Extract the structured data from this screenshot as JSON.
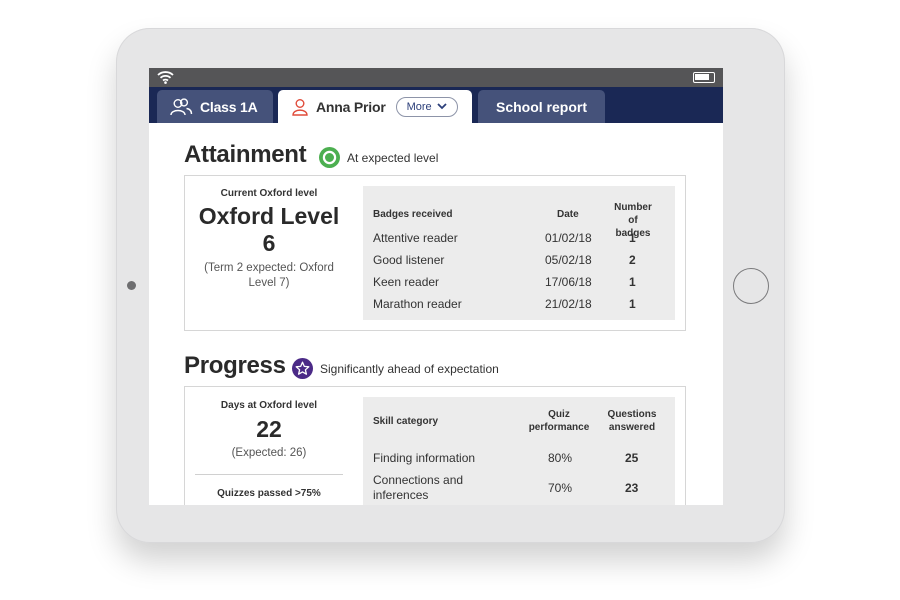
{
  "colors": {
    "navy": "#1a2855",
    "tab_inactive": "#45527a",
    "status_green": "#4caf50",
    "status_purple": "#4b2a87",
    "student_icon": "#e04b3a"
  },
  "tabs": {
    "class_label": "Class 1A",
    "student_label": "Anna Prior",
    "more_label": "More",
    "report_label": "School report"
  },
  "attainment": {
    "title": "Attainment",
    "status": "At expected level",
    "current_label": "Current Oxford level",
    "level_line1": "Oxford Level",
    "level_line2": "6",
    "expected": "(Term 2 expected: Oxford Level 7)",
    "table": {
      "headers": [
        "Badges received",
        "Date",
        "Number of badges"
      ],
      "rows": [
        [
          "Attentive reader",
          "01/02/18",
          "1"
        ],
        [
          "Good listener",
          "05/02/18",
          "2"
        ],
        [
          "Keen reader",
          "17/06/18",
          "1"
        ],
        [
          "Marathon reader",
          "21/02/18",
          "1"
        ]
      ]
    }
  },
  "progress": {
    "title": "Progress",
    "status": "Significantly ahead of expectation",
    "days_label": "Days at Oxford level",
    "days_value": "22",
    "days_expected": "(Expected: 26)",
    "quizzes_label": "Quizzes passed >75%",
    "table": {
      "headers": [
        "Skill category",
        "Quiz performance",
        "Questions answered"
      ],
      "rows": [
        [
          "Finding information",
          "80%",
          "25"
        ],
        [
          "Connections and inferences",
          "70%",
          "23"
        ]
      ]
    }
  }
}
